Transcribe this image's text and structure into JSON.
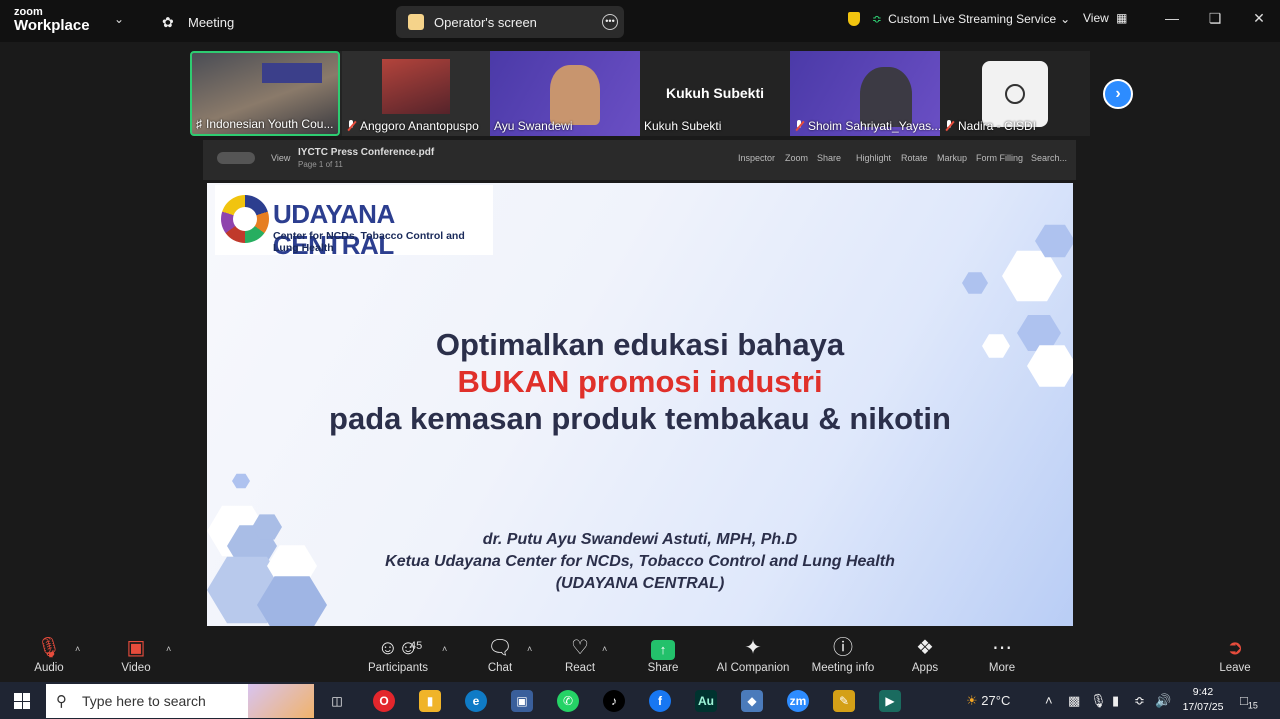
{
  "app": {
    "brand_line1": "zoom",
    "brand_line2": "Workplace"
  },
  "tabs": {
    "meeting": "Meeting",
    "operator": "Operator's screen"
  },
  "topright": {
    "stream": "Custom Live Streaming Service",
    "view": "View"
  },
  "participants_strip": [
    {
      "name": "Indonesian Youth Cou...",
      "muted": false
    },
    {
      "name": "Anggoro Anantopuspo",
      "muted": true
    },
    {
      "name": "Ayu Swandewi",
      "muted": false
    },
    {
      "name": "Kukuh Subekti",
      "label": "Kukuh Subekti",
      "muted": false
    },
    {
      "name": "Shoim Sahriyati_Yayas...",
      "muted": true
    },
    {
      "name": "Nadira - CISDI",
      "muted": true
    }
  ],
  "pdf": {
    "view": "View",
    "file": "IYCTC Press Conference.pdf",
    "page": "Page 1 of 11",
    "tools": [
      "Inspector",
      "Zoom",
      "Share",
      "Highlight",
      "Rotate",
      "Markup",
      "Form Filling",
      "Search..."
    ]
  },
  "slide": {
    "logo_title": "UDAYANA CENTRAL",
    "logo_subtitle": "Center for NCDs, Tobacco Control and Lung Health",
    "line1": "Optimalkan edukasi bahaya",
    "line2a": "BUKAN",
    "line2b": " promosi industri",
    "line3": "pada kemasan produk tembakau & nikotin",
    "credit1": "dr. Putu Ayu Swandewi Astuti, MPH, Ph.D",
    "credit2": "Ketua Udayana Center for NCDs, Tobacco Control and Lung Health",
    "credit3": "(UDAYANA CENTRAL)"
  },
  "controls": {
    "audio": "Audio",
    "video": "Video",
    "participants": "Participants",
    "participants_count": "45",
    "chat": "Chat",
    "react": "React",
    "share": "Share",
    "ai": "AI Companion",
    "info": "Meeting info",
    "apps": "Apps",
    "more": "More",
    "leave": "Leave"
  },
  "taskbar": {
    "search": "Type here to search",
    "weather": "27°C",
    "time": "9:42",
    "date": "17/07/25",
    "notifications": "15"
  },
  "colors": {
    "zoom_blue": "#2d8cff",
    "share_green": "#23c16b",
    "active_border": "#2ecc71",
    "slide_red": "#e0302a"
  }
}
